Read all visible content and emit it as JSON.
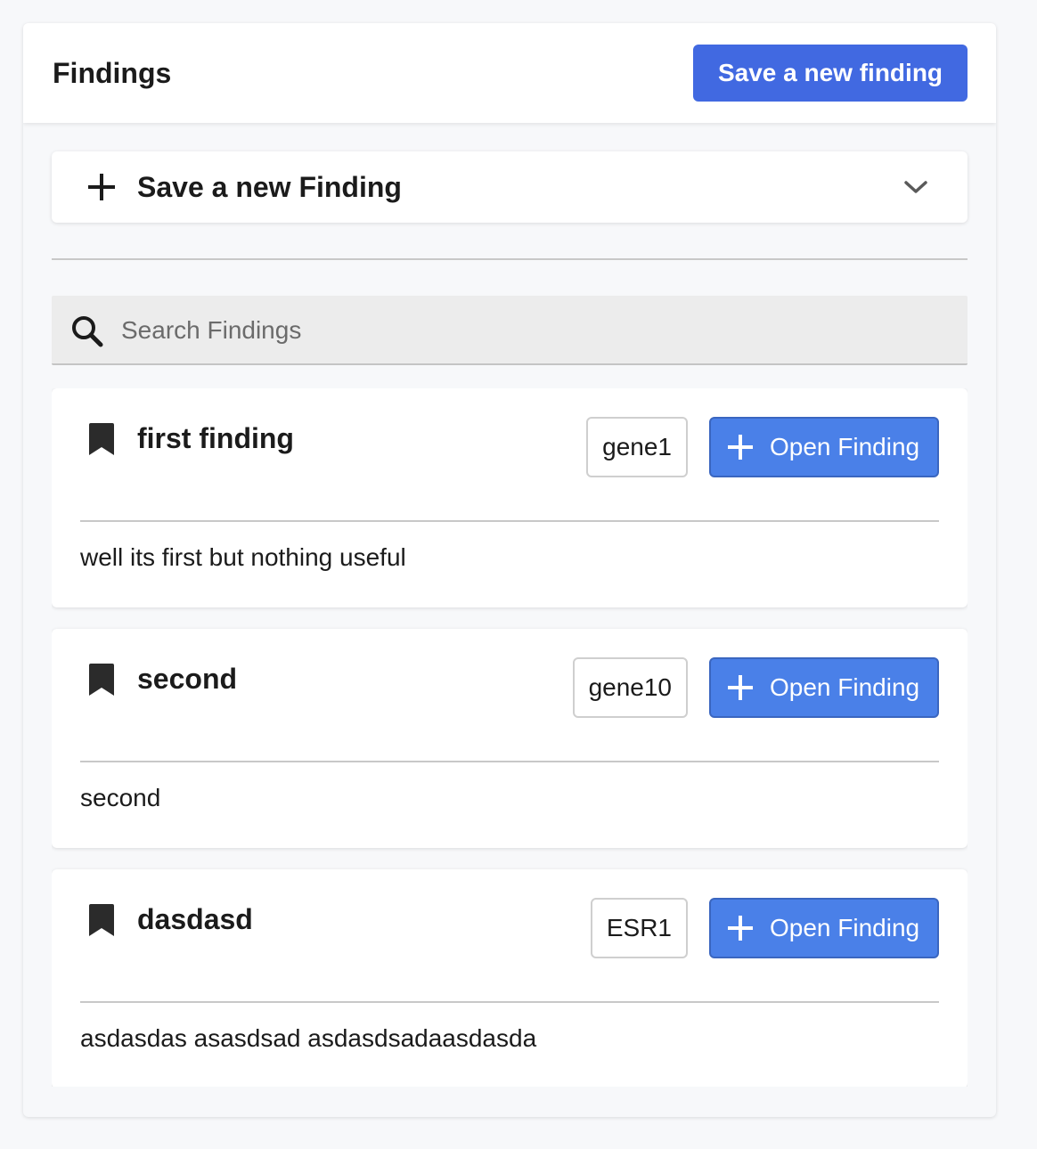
{
  "header": {
    "title": "Findings",
    "save_button_label": "Save a new finding"
  },
  "accordion": {
    "icon": "plus-icon",
    "label": "Save a new Finding",
    "toggle_icon": "chevron-down-icon"
  },
  "search": {
    "icon": "search-icon",
    "placeholder": "Search Findings",
    "value": ""
  },
  "findings": [
    {
      "icon": "bookmark-icon",
      "title": "first finding",
      "gene": "gene1",
      "open_label": "Open Finding",
      "description": "well its first but nothing useful"
    },
    {
      "icon": "bookmark-icon",
      "title": "second",
      "gene": "gene10",
      "open_label": "Open Finding",
      "description": "second"
    },
    {
      "icon": "bookmark-icon",
      "title": "dasdasd",
      "gene": "ESR1",
      "open_label": "Open Finding",
      "description": "asdasdas asasdsad asdasdsadaasdasda"
    }
  ],
  "colors": {
    "primary": "#4169e1",
    "open_button": "#4a80e8",
    "background": "#f7f8fa",
    "card": "#ffffff",
    "text": "#1b1b1b"
  }
}
